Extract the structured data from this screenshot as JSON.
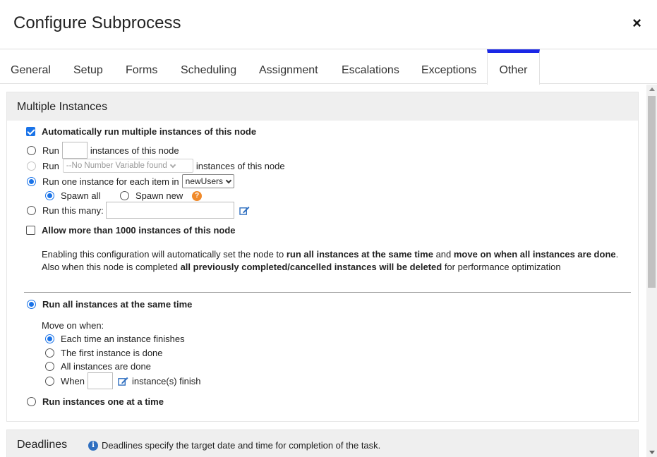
{
  "dialog": {
    "title": "Configure Subprocess",
    "close_icon": "×"
  },
  "tabs": [
    {
      "label": "General",
      "active": false
    },
    {
      "label": "Setup",
      "active": false
    },
    {
      "label": "Forms",
      "active": false
    },
    {
      "label": "Scheduling",
      "active": false
    },
    {
      "label": "Assignment",
      "active": false
    },
    {
      "label": "Escalations",
      "active": false
    },
    {
      "label": "Exceptions",
      "active": false
    },
    {
      "label": "Other",
      "active": true
    }
  ],
  "multiple_instances": {
    "heading": "Multiple Instances",
    "auto_run_label": "Automatically run multiple instances of this node",
    "auto_run_checked": true,
    "run_label": "Run",
    "run_n_suffix": "instances of this node",
    "run_n_value": "",
    "run_var_select": "--No Number Variable found",
    "run_var_suffix": "instances of this node",
    "run_each_label": "Run one instance for each item in",
    "run_each_select": "newUsers",
    "spawn_all_label": "Spawn all",
    "spawn_new_label": "Spawn new",
    "help_icon": "?",
    "run_many_label": "Run this many:",
    "run_many_value": "",
    "allow_more_label": "Allow more than 1000 instances of this node",
    "allow_more_checked": false,
    "para": {
      "p1": "Enabling this configuration will automatically set the node to ",
      "b1": "run all instances at the same time",
      "p2": " and ",
      "b2": "move on when all instances are done",
      "p3": ". Also when this node is completed ",
      "b3": "all previously completed/cancelled instances will be deleted",
      "p4": " for performance optimization"
    },
    "run_same_time_label": "Run all instances at the same time",
    "move_on_label": "Move on when:",
    "move_options": {
      "each": "Each time an instance finishes",
      "first": "The first instance is done",
      "all": "All instances are done",
      "when": "When",
      "when_suffix": "instance(s) finish",
      "when_value": ""
    },
    "run_one_at_time_label": "Run instances one at a time"
  },
  "deadlines": {
    "heading": "Deadlines",
    "info_icon": "i",
    "info_text": "Deadlines specify the target date and time for completion of the task."
  },
  "colors": {
    "accent": "#1a27e6",
    "radio": "#1a73e8",
    "help": "#f08a2b",
    "info": "#2f6fc0"
  }
}
